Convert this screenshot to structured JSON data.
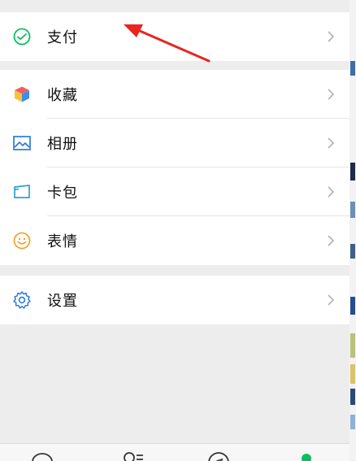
{
  "menu": {
    "group1": [
      {
        "label": "支付",
        "icon": "wechat-pay-icon"
      }
    ],
    "group2": [
      {
        "label": "收藏",
        "icon": "favorites-cube-icon"
      },
      {
        "label": "相册",
        "icon": "album-picture-icon"
      },
      {
        "label": "卡包",
        "icon": "card-wallet-icon"
      },
      {
        "label": "表情",
        "icon": "sticker-smiley-icon"
      }
    ],
    "group3": [
      {
        "label": "设置",
        "icon": "settings-gear-icon"
      }
    ]
  },
  "tabbar": {
    "tabs": [
      "chat-tab-icon",
      "contacts-tab-icon",
      "discover-tab-icon",
      "me-tab-icon"
    ],
    "active": "me-tab-icon"
  },
  "colors": {
    "brand_green": "#07c160",
    "annotation_arrow": "#e8251f"
  }
}
